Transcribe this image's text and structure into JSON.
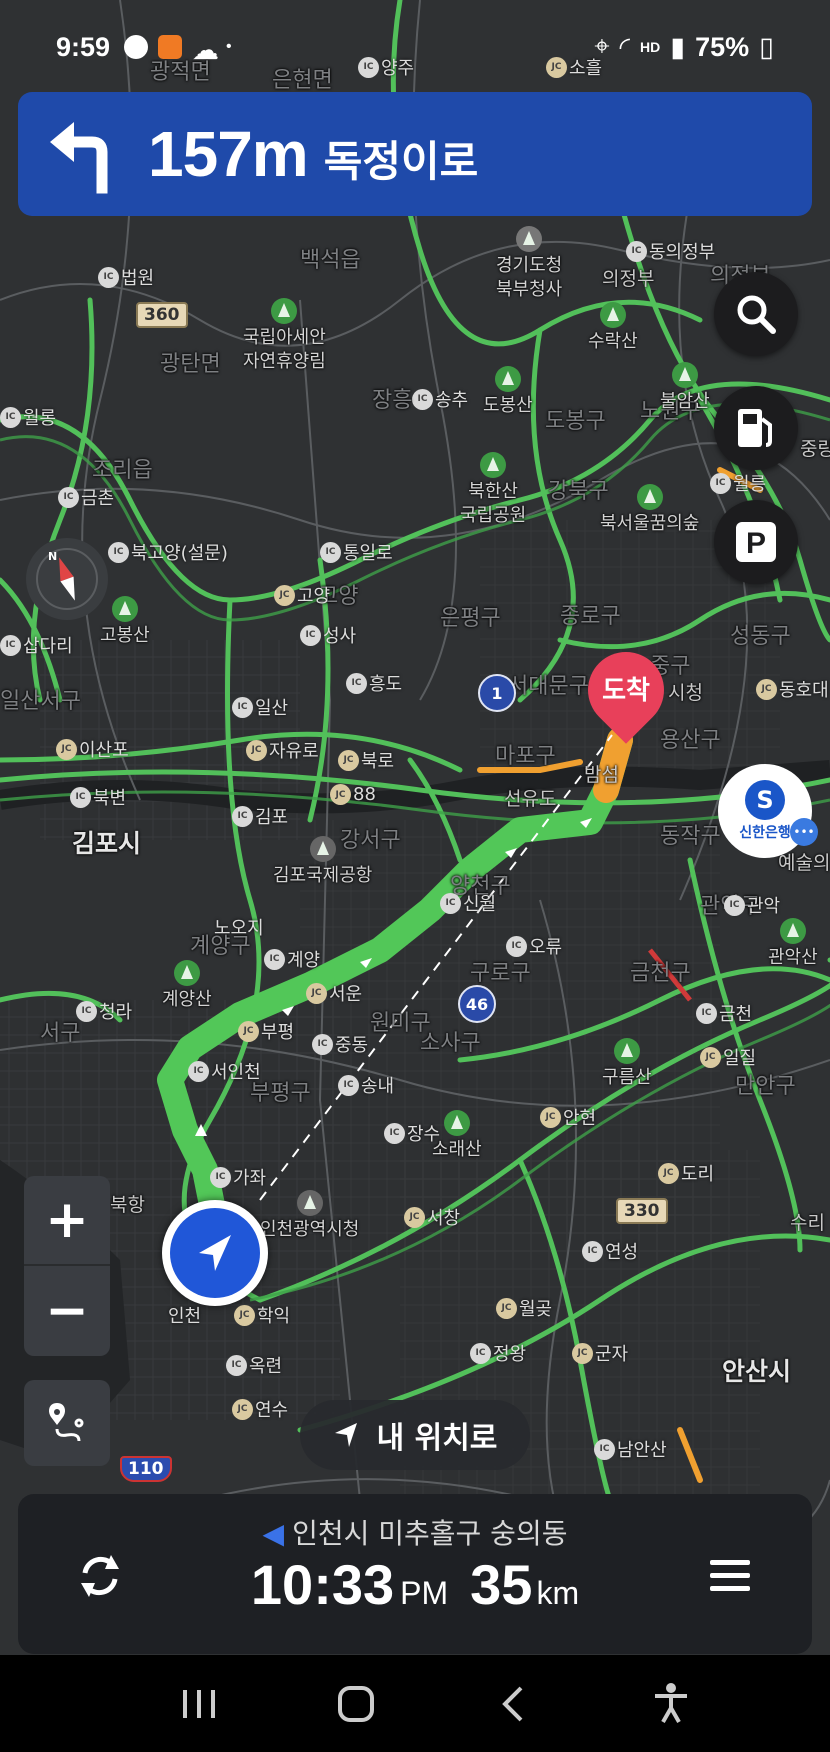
{
  "status_bar": {
    "time": "9:59",
    "battery": "75%",
    "network": "HD"
  },
  "turn_banner": {
    "distance": "157m",
    "road": "독정이로",
    "turn_direction": "left-turn-icon",
    "color": "#1f4aaa"
  },
  "map": {
    "destination_label": "도착",
    "bank_name": "신한은행",
    "bank_logo": "S",
    "city_labels": [
      "김포시",
      "안산시"
    ],
    "district_labels": [
      "계양구",
      "부평구",
      "강서구",
      "양천구",
      "구로구",
      "원미구",
      "소사구",
      "금천구",
      "관악구",
      "동작구",
      "마포구",
      "서대문구",
      "은평구",
      "종로구",
      "강북구",
      "도봉구",
      "노원구",
      "중구",
      "성동구",
      "용산구",
      "만안구",
      "서구",
      "의정부",
      "고양",
      "일산서구"
    ],
    "poi_labels": [
      "국립아세안\n자연휴양림",
      "도봉산",
      "북한산\n국립공원",
      "북서울꿈의숲",
      "수락산",
      "불암산",
      "경기도청\n북부청사",
      "김포국제공항",
      "계양산",
      "구름산",
      "소래산",
      "관악산",
      "인천광역시청",
      "예술의",
      "고봉산"
    ],
    "place_labels": [
      "법원",
      "금촌",
      "월롱",
      "북고양(설문)",
      "통일로",
      "고양",
      "성사",
      "흥도",
      "일산",
      "자유로",
      "북로",
      "김포",
      "북변",
      "이산포",
      "삽다리",
      "88",
      "신월",
      "오류",
      "서운",
      "부평",
      "중동",
      "송내",
      "서인천",
      "가좌",
      "청라",
      "노오지",
      "계양",
      "안현",
      "장수",
      "도리",
      "서창",
      "연성",
      "월곶",
      "정왕",
      "군자",
      "남안산",
      "학익",
      "옥련",
      "연수",
      "인천",
      "금천",
      "일질",
      "관악",
      "동호대",
      "시청",
      "선유도",
      "밤섬",
      "양주",
      "소흘",
      "동의정부",
      "송추",
      "월릉",
      "의정부",
      "북항",
      "광탄면",
      "은현면",
      "조리읍",
      "광적면",
      "백석읍",
      "장흥",
      "수리",
      "중랑"
    ],
    "route_shields": [
      "360",
      "1",
      "46",
      "330",
      "110"
    ],
    "route_color": "#49c64d",
    "traffic_slow_color": "#f0a030"
  },
  "controls": {
    "zoom_in": "+",
    "zoom_out": "−",
    "my_location": "내 위치로"
  },
  "bottom_panel": {
    "destination": "인천시 미추홀구 숭의동",
    "eta_time": "10:33",
    "eta_ampm": "PM",
    "distance": "35",
    "distance_unit": "km"
  }
}
